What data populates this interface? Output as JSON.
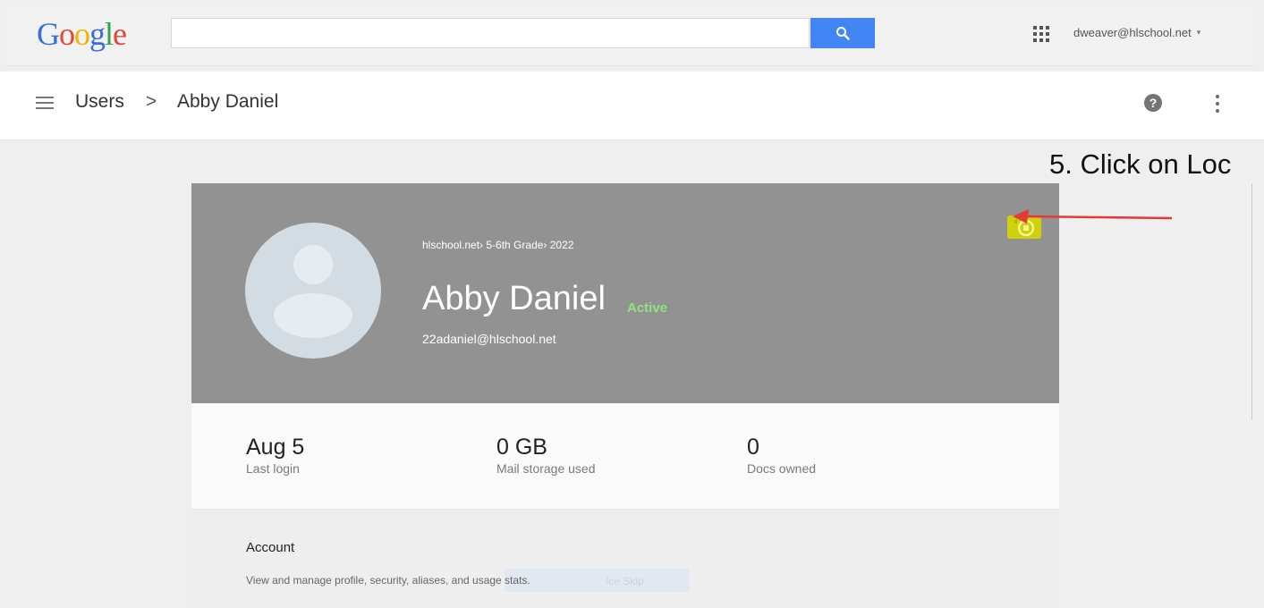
{
  "topbar": {
    "logo_letters": [
      "G",
      "o",
      "o",
      "g",
      "l",
      "e"
    ],
    "search_value": "",
    "search_icon": "search-icon",
    "apps_icon": "apps-grid-icon",
    "account_email": "dweaver@hlschool.net",
    "account_caret": "▾"
  },
  "breadcrumb": {
    "menu_icon": "hamburger-menu-icon",
    "root": "Users",
    "separator": ">",
    "current": "Abby Daniel",
    "help_icon": "help-icon",
    "more_icon": "more-vert-icon"
  },
  "annotation": {
    "text": "5. Click on Loc",
    "arrow_color": "#e53935"
  },
  "user": {
    "org_path": "hlschool.net› 5-6th Grade› 2022",
    "name": "Abby Daniel",
    "status": "Active",
    "email": "22adaniel@hlschool.net",
    "lock_icon": "lock-icon",
    "highlight_color": "#d7d800"
  },
  "stats": [
    {
      "value": "Aug 5",
      "label": "Last login"
    },
    {
      "value": "0 GB",
      "label": "Mail storage used"
    },
    {
      "value": "0",
      "label": "Docs owned"
    }
  ],
  "account_section": {
    "title": "Account",
    "description": "View and manage profile, security, aliases, and usage stats.",
    "ghost_text": "Ice Skip"
  },
  "colors": {
    "search_blue": "#4285f4",
    "header_gray": "#929292",
    "active_green": "#8ee57f"
  }
}
